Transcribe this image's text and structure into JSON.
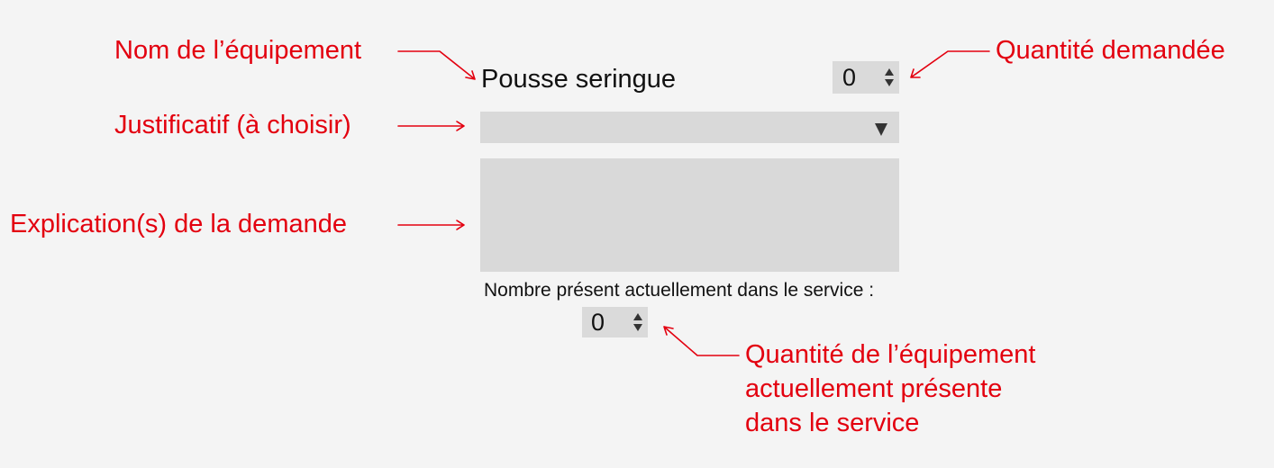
{
  "annotations": {
    "equipment_name": "Nom de l’équipement",
    "requested_quantity": "Quantité demandée",
    "justification": "Justificatif (à choisir)",
    "explanation": "Explication(s) de la demande",
    "present_quantity_lines": [
      "Quantité de l’équipement",
      "actuellement présente",
      "dans le service"
    ]
  },
  "form": {
    "equipment_name": "Pousse seringue",
    "requested_quantity": "0",
    "justification_selected": "",
    "explanation_value": "",
    "present_label": "Nombre présent actuellement dans le service :",
    "present_quantity": "0"
  },
  "icons": {
    "select_caret": "caret-down-icon",
    "stepper_up": "caret-up-icon",
    "stepper_down": "caret-down-icon"
  },
  "colors": {
    "annotation": "#e3000f",
    "background": "#f4f4f4",
    "field": "#d9d9d9",
    "text": "#111111"
  }
}
